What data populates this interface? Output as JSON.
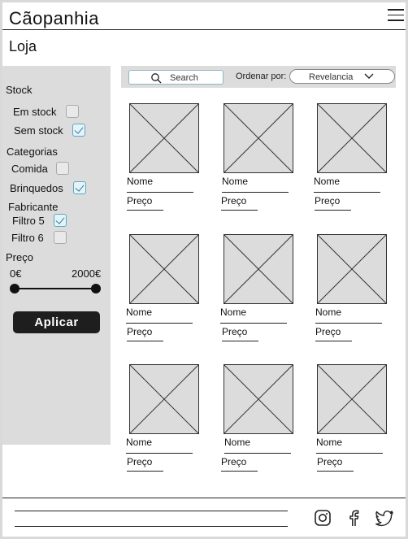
{
  "app": {
    "brand": "Cãopanhia",
    "page_title": "Loja"
  },
  "filters": {
    "stock_title": "Stock",
    "stock_items": [
      {
        "label": "Em stock",
        "checked": false
      },
      {
        "label": "Sem stock",
        "checked": true
      }
    ],
    "categories_title": "Categorias",
    "category_items": [
      {
        "label": "Comida",
        "checked": false
      },
      {
        "label": "Brinquedos",
        "checked": true
      }
    ],
    "manufacturer_title": "Fabricante",
    "manufacturer_items": [
      {
        "label": "Filtro 5",
        "checked": true
      },
      {
        "label": "Filtro 6",
        "checked": false
      }
    ],
    "price_title": "Preço",
    "price_min": "0€",
    "price_max": "2000€",
    "apply_label": "Aplicar"
  },
  "toolbar": {
    "search_placeholder": "Search",
    "sort_label": "Ordenar por:",
    "sort_value": "Revelancia"
  },
  "products": [
    {
      "name": "Nome",
      "price": "Preço"
    },
    {
      "name": "Nome",
      "price": "Preço"
    },
    {
      "name": "Nome",
      "price": "Preço"
    },
    {
      "name": "Nome",
      "price": "Preço"
    },
    {
      "name": "Nome",
      "price": "Preço"
    },
    {
      "name": "Nome",
      "price": "Preço"
    },
    {
      "name": "Nome",
      "price": "Preço"
    },
    {
      "name": "Nome",
      "price": "Preço"
    },
    {
      "name": "Nome",
      "price": "Preço"
    }
  ],
  "footer": {
    "icons": [
      "instagram-icon",
      "facebook-icon",
      "twitter-icon"
    ]
  },
  "colors": {
    "panel": "#dcdcdc",
    "accent": "#5aa8c8",
    "button": "#1e1e1e"
  }
}
